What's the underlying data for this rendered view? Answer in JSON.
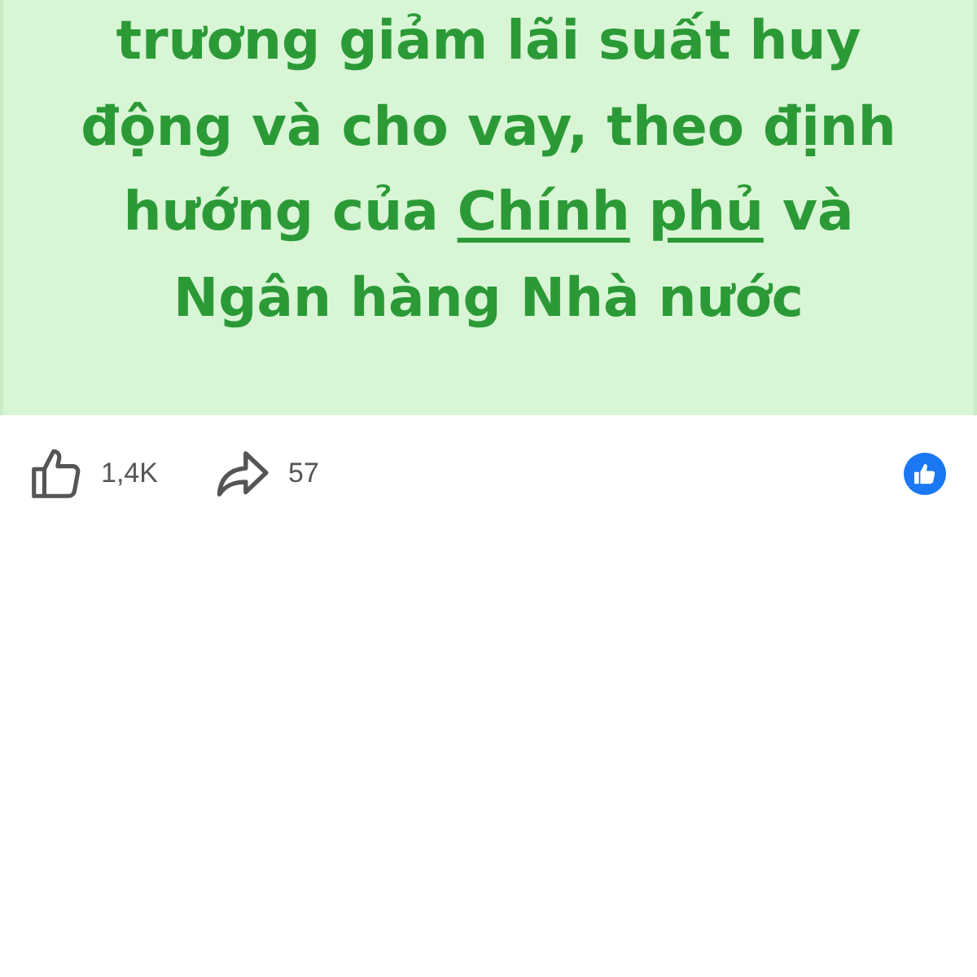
{
  "post_text": {
    "lines": [
      [
        {
          "kind": "plain",
          "text": "trương giảm lãi suất huy"
        }
      ],
      [
        {
          "kind": "plain",
          "text": "động và cho vay, theo định"
        }
      ],
      [
        {
          "kind": "plain",
          "text": "hướng của "
        },
        {
          "kind": "link",
          "text": "Chính phủ"
        },
        {
          "kind": "plain",
          "text": " và"
        }
      ],
      [
        {
          "kind": "plain",
          "text": "Ngân hàng Nhà nước"
        }
      ]
    ]
  },
  "actions": [
    {
      "kind": "like",
      "count": "1,4K"
    },
    {
      "kind": "share",
      "count": "57"
    }
  ],
  "reaction_summary": {
    "kind": "like"
  }
}
